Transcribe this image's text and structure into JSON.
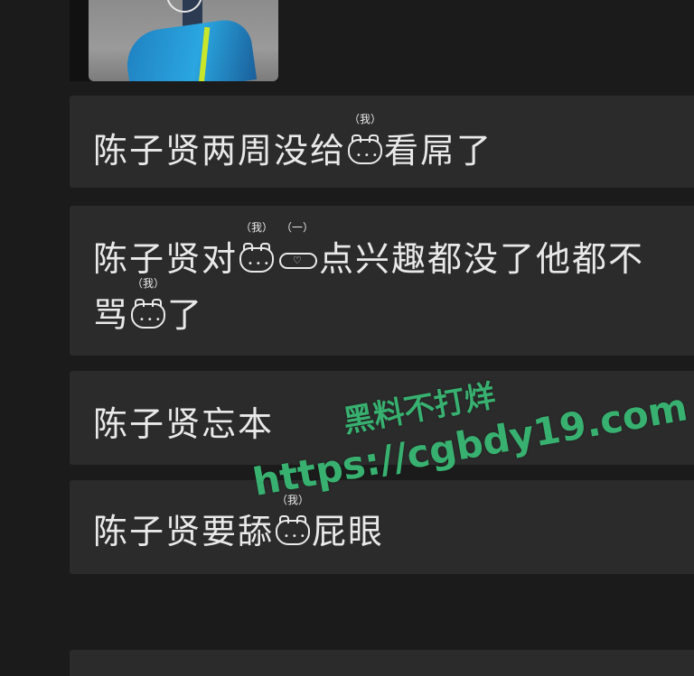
{
  "messages": [
    {
      "before": "陈子贤两周没给",
      "emoji_tag": "（我）",
      "after": "看屌了"
    },
    {
      "line1_before": "陈子贤对",
      "emoji_tag": "（我）",
      "heart_tag": "（一）",
      "line1_after": "点兴趣都没了他都不",
      "line2_before": "骂",
      "line2_emoji_tag": "（我）",
      "line2_after": "了"
    },
    {
      "text": "陈子贤忘本"
    },
    {
      "before": "陈子贤要舔",
      "emoji_tag": "（我）",
      "after": "屁眼"
    }
  ],
  "watermark": {
    "line1": "黑料不打烊",
    "line2": "https://cgbdy19.com"
  },
  "colors": {
    "background": "#1b1b1b",
    "bubble": "#2b2b2b",
    "text": "#e9e9e9",
    "watermark": "#38b070"
  }
}
